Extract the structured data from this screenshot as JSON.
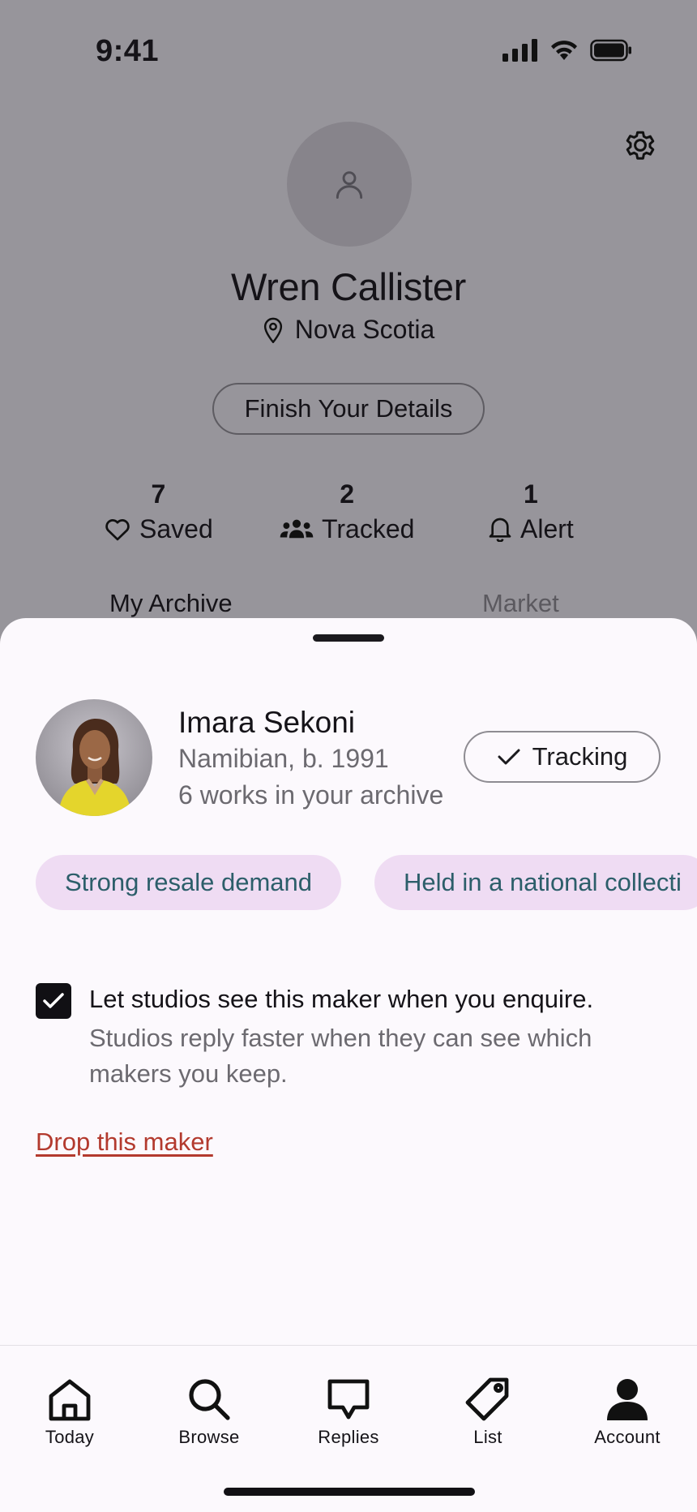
{
  "status_bar": {
    "time": "9:41"
  },
  "profile": {
    "name": "Wren Callister",
    "location": "Nova Scotia",
    "finish_button": "Finish Your Details",
    "stats": [
      {
        "count": "7",
        "label": "Saved",
        "icon": "heart-icon"
      },
      {
        "count": "2",
        "label": "Tracked",
        "icon": "people-icon"
      },
      {
        "count": "1",
        "label": "Alert",
        "icon": "bell-icon"
      }
    ],
    "tabs": [
      {
        "label": "My Archive",
        "active": true
      },
      {
        "label": "Market",
        "active": false
      }
    ]
  },
  "sheet": {
    "maker": {
      "name": "Imara Sekoni",
      "origin": "Namibian, b. 1991",
      "works": "6 works in your archive"
    },
    "tracking_button": "Tracking",
    "chips": [
      "Strong resale demand",
      "Held in a national collecti"
    ],
    "consent": {
      "checked": true,
      "title": "Let studios see this maker when you enquire.",
      "help": "Studios reply faster when they can see which makers you keep."
    },
    "drop_link": "Drop this maker"
  },
  "tab_bar": {
    "items": [
      {
        "label": "Today",
        "icon": "home-icon"
      },
      {
        "label": "Browse",
        "icon": "search-icon"
      },
      {
        "label": "Replies",
        "icon": "chat-icon"
      },
      {
        "label": "List",
        "icon": "tag-icon"
      },
      {
        "label": "Account",
        "icon": "person-icon"
      }
    ]
  },
  "colors": {
    "overlay_background": "#97959b",
    "sheet_background": "#fcf9fd",
    "chip_background": "#efdcf3",
    "chip_text": "#2c5e6a",
    "destructive": "#b33a2e"
  }
}
